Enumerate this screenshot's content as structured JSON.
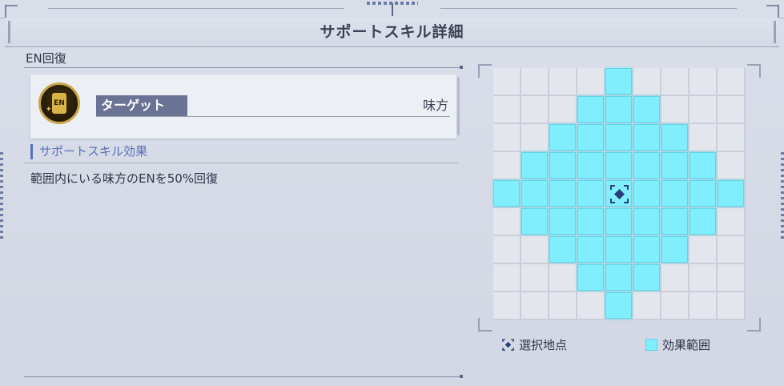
{
  "header": {
    "title": "サポートスキル詳細"
  },
  "skill": {
    "name": "EN回復",
    "icon": {
      "name": "en-battery-icon",
      "label": "EN"
    },
    "target_label": "ターゲット",
    "target_value": "味方",
    "effect_title": "サポートスキル効果",
    "effect_description": "範囲内にいる味方のENを50%回復"
  },
  "range_grid": {
    "size": 9,
    "center": [
      4,
      4
    ],
    "rows": [
      "....X....",
      "...XXX...",
      "..XXXXX..",
      ".XXXXXXX.",
      "XXXXSXXXX",
      ".XXXXXXX.",
      "..XXXXX..",
      "...XXX...",
      "....X...."
    ]
  },
  "legend": {
    "selected_label": "選択地点",
    "effect_label": "効果範囲"
  },
  "colors": {
    "effect": "#80eefc",
    "selected_marker": "#2b3f7a",
    "accent": "#5870b8"
  }
}
